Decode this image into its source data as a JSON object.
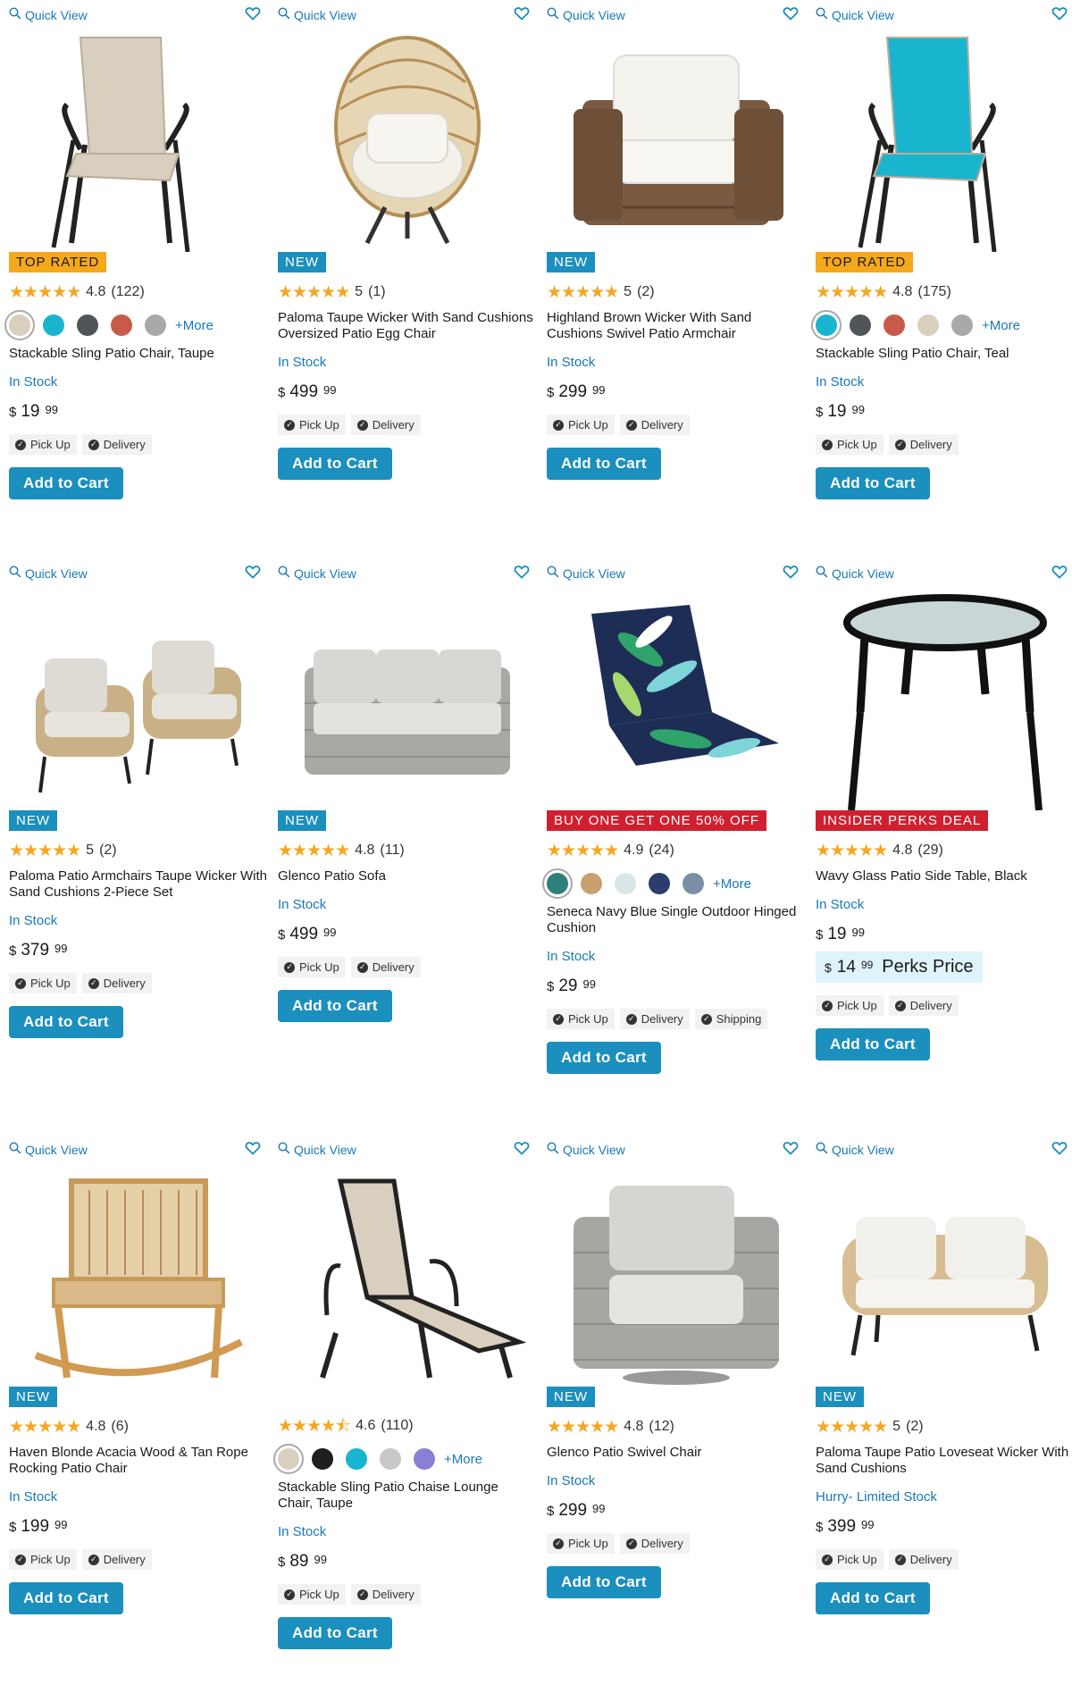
{
  "common": {
    "quick_view": "Quick View",
    "add_to_cart": "Add to Cart",
    "pick_up": "Pick Up",
    "delivery": "Delivery",
    "shipping": "Shipping",
    "more": "+More",
    "currency": "$"
  },
  "colors": {
    "accent": "#1b8fbd",
    "link": "#1779ba",
    "top_rated_badge": "#f6a81b",
    "promo_badge": "#d0202f",
    "star": "#f5a623",
    "perks_bg": "#dff3fb"
  },
  "products": [
    {
      "badge": "TOP RATED",
      "rating": "4.8",
      "reviews": "(122)",
      "swatches": [
        "#d9cfbf",
        "#19b5cf",
        "#505558",
        "#c95a4a",
        "#a9a9a9"
      ],
      "title": "Stackable Sling Patio Chair, Taupe",
      "stock": "In Stock",
      "price_dollars": "19",
      "price_cents": "99",
      "image": "chair-taupe"
    },
    {
      "badge": "NEW",
      "rating": "5",
      "reviews": "(1)",
      "title": "Paloma Taupe Wicker With Sand Cushions Oversized Patio Egg Chair",
      "stock": "In Stock",
      "price_dollars": "499",
      "price_cents": "99",
      "image": "egg-chair"
    },
    {
      "badge": "NEW",
      "rating": "5",
      "reviews": "(2)",
      "title": "Highland Brown Wicker With Sand Cushions Swivel Patio Armchair",
      "stock": "In Stock",
      "price_dollars": "299",
      "price_cents": "99",
      "image": "brown-armchair"
    },
    {
      "badge": "TOP RATED",
      "rating": "4.8",
      "reviews": "(175)",
      "swatches": [
        "#19b5cf",
        "#505558",
        "#c95a4a",
        "#d9cfbf",
        "#a9a9a9"
      ],
      "title": "Stackable Sling Patio Chair, Teal",
      "stock": "In Stock",
      "price_dollars": "19",
      "price_cents": "99",
      "image": "chair-teal"
    },
    {
      "badge": "NEW",
      "rating": "5",
      "reviews": "(2)",
      "title": "Paloma Patio Armchairs Taupe Wicker With Sand Cushions 2-Piece Set",
      "stock": "In Stock",
      "price_dollars": "379",
      "price_cents": "99",
      "image": "armchair-set"
    },
    {
      "badge": "NEW",
      "rating": "4.8",
      "reviews": "(11)",
      "title": "Glenco Patio Sofa",
      "stock": "In Stock",
      "price_dollars": "499",
      "price_cents": "99",
      "image": "sofa"
    },
    {
      "badge": "BUY ONE GET ONE 50% OFF",
      "rating": "4.9",
      "reviews": "(24)",
      "swatches": [
        "#2f7f7a",
        "#c9a070",
        "#d8e6e8",
        "#2b3c6e",
        "#7a8fa6"
      ],
      "title": "Seneca Navy Blue Single Outdoor Hinged Cushion",
      "stock": "In Stock",
      "price_dollars": "29",
      "price_cents": "99",
      "image": "cushion"
    },
    {
      "badge": "INSIDER PERKS DEAL",
      "rating": "4.8",
      "reviews": "(29)",
      "title": "Wavy Glass Patio Side Table, Black",
      "stock": "In Stock",
      "price_dollars": "19",
      "price_cents": "99",
      "perks_dollars": "14",
      "perks_cents": "99",
      "perks_label": "Perks Price",
      "image": "side-table"
    },
    {
      "badge": "NEW",
      "rating": "4.8",
      "reviews": "(6)",
      "title": "Haven Blonde Acacia Wood & Tan Rope Rocking Patio Chair",
      "stock": "In Stock",
      "price_dollars": "199",
      "price_cents": "99",
      "image": "rocking-chair"
    },
    {
      "rating": "4.6",
      "reviews": "(110)",
      "swatches": [
        "#d9cfbf",
        "#1f1f1f",
        "#19b5cf",
        "#c8c8c8",
        "#8a7fd6"
      ],
      "title": "Stackable Sling Patio Chaise Lounge Chair, Taupe",
      "stock": "In Stock",
      "price_dollars": "89",
      "price_cents": "99",
      "image": "chaise"
    },
    {
      "badge": "NEW",
      "rating": "4.8",
      "reviews": "(12)",
      "title": "Glenco Patio Swivel Chair",
      "stock": "In Stock",
      "price_dollars": "299",
      "price_cents": "99",
      "image": "swivel-chair"
    },
    {
      "badge": "NEW",
      "rating": "5",
      "reviews": "(2)",
      "title": "Paloma Taupe Patio Loveseat Wicker With Sand Cushions",
      "stock": "Hurry- Limited Stock",
      "price_dollars": "399",
      "price_cents": "99",
      "image": "loveseat"
    }
  ]
}
